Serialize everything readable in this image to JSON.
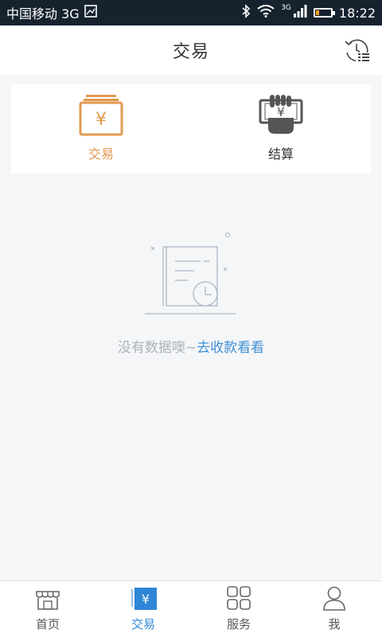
{
  "status_bar": {
    "carrier": "中国移动 3G",
    "network": "3G",
    "time": "18:22"
  },
  "header": {
    "title": "交易",
    "history_icon": "history-list-icon"
  },
  "tabs": [
    {
      "label": "交易",
      "icon": "wallet-yen-icon",
      "active": true
    },
    {
      "label": "结算",
      "icon": "hand-money-icon",
      "active": false
    }
  ],
  "empty_state": {
    "message": "没有数据噢~",
    "action_link": "去收款看看",
    "icon": "document-clock-icon"
  },
  "bottom_nav": [
    {
      "label": "首页",
      "icon": "store-icon",
      "active": false
    },
    {
      "label": "交易",
      "icon": "yen-tag-icon",
      "active": true
    },
    {
      "label": "服务",
      "icon": "grid-icon",
      "active": false
    },
    {
      "label": "我",
      "icon": "user-icon",
      "active": false
    }
  ],
  "colors": {
    "accent_orange": "#e09a50",
    "accent_blue": "#2f86d6",
    "link_blue": "#3e8fd6",
    "status_bar_bg": "#16222e"
  }
}
